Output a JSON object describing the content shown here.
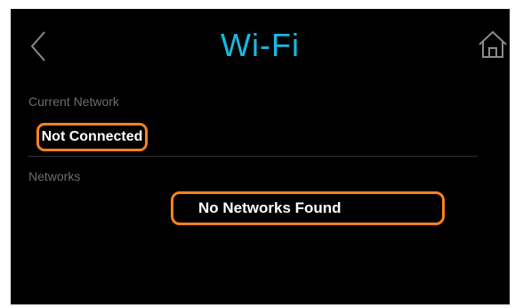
{
  "header": {
    "title": "Wi-Fi",
    "back_icon": "chevron-left-icon",
    "home_icon": "home-icon",
    "title_color": "#18b9e0"
  },
  "current_network": {
    "label": "Current Network",
    "value": "Not Connected"
  },
  "networks": {
    "label": "Networks",
    "empty_message": "No Networks Found"
  },
  "colors": {
    "background": "#000000",
    "highlight": "#f7821e",
    "section_label": "#6d6d6d",
    "text": "#ffffff"
  }
}
